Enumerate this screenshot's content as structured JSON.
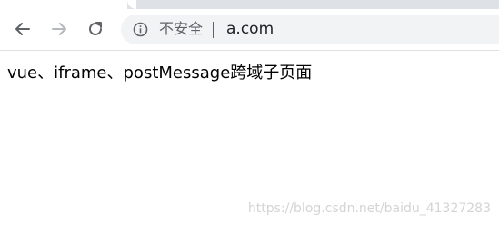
{
  "browser": {
    "security_text": "不安全",
    "url": "a.com",
    "icons": {
      "back": "back-arrow-icon",
      "forward": "forward-arrow-icon",
      "reload": "reload-icon",
      "info": "info-icon"
    }
  },
  "page": {
    "text": "vue、iframe、postMessage跨域子页面"
  },
  "watermark": "https://blog.csdn.net/baidu_41327283",
  "colors": {
    "toolbar_bg": "#ffffff",
    "omnibox_bg": "#f1f3f4",
    "icon_active": "#5f6368",
    "icon_disabled": "#b5b8bc",
    "tabstrip_bg": "#dee1e6"
  }
}
